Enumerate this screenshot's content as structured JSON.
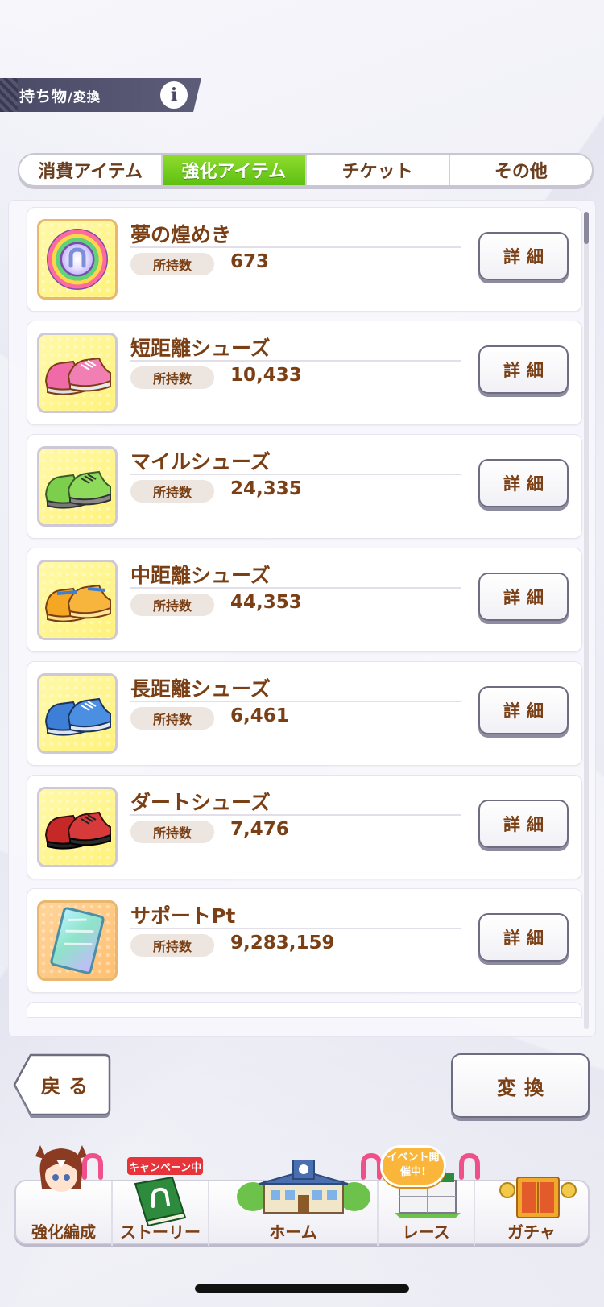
{
  "header": {
    "title_main": "持ち物",
    "title_sep": "/",
    "title_sub": "変換",
    "info_label": "i"
  },
  "tabs": [
    {
      "label": "消費アイテム",
      "active": false
    },
    {
      "label": "強化アイテム",
      "active": true
    },
    {
      "label": "チケット",
      "active": false
    },
    {
      "label": "その他",
      "active": false
    }
  ],
  "items": [
    {
      "name": "夢の煌めき",
      "qty_label": "所持数",
      "qty": "673",
      "detail": "詳細",
      "icon": "rainbow-horseshoe-medal-icon"
    },
    {
      "name": "短距離シューズ",
      "qty_label": "所持数",
      "qty": "10,433",
      "detail": "詳細",
      "icon": "pink-shoes-icon",
      "color": "#f06aa8"
    },
    {
      "name": "マイルシューズ",
      "qty_label": "所持数",
      "qty": "24,335",
      "detail": "詳細",
      "icon": "green-shoes-icon",
      "color": "#7ccf4c"
    },
    {
      "name": "中距離シューズ",
      "qty_label": "所持数",
      "qty": "44,353",
      "detail": "詳細",
      "icon": "orange-shoes-icon",
      "color": "#f5a623"
    },
    {
      "name": "長距離シューズ",
      "qty_label": "所持数",
      "qty": "6,461",
      "detail": "詳細",
      "icon": "blue-shoes-icon",
      "color": "#3d7fd6"
    },
    {
      "name": "ダートシューズ",
      "qty_label": "所持数",
      "qty": "7,476",
      "detail": "詳細",
      "icon": "red-shoes-icon",
      "color": "#c62828"
    },
    {
      "name": "サポートPt",
      "qty_label": "所持数",
      "qty": "9,283,159",
      "detail": "詳細",
      "icon": "support-card-icon"
    }
  ],
  "buttons": {
    "back": "戻る",
    "convert": "変換"
  },
  "nav": {
    "items": [
      {
        "label": "強化編成"
      },
      {
        "label": "ストーリー",
        "badge": "キャンペーン中"
      },
      {
        "label": "ホーム"
      },
      {
        "label": "レース",
        "badge": "イベント開催中!"
      },
      {
        "label": "ガチャ"
      }
    ]
  },
  "colors": {
    "accent_green": "#6ccb1a",
    "text_brown": "#7a3f14",
    "header_bg": "#4a4a66",
    "campaign_red": "#e6343a",
    "event_orange": "#f9b63a"
  }
}
